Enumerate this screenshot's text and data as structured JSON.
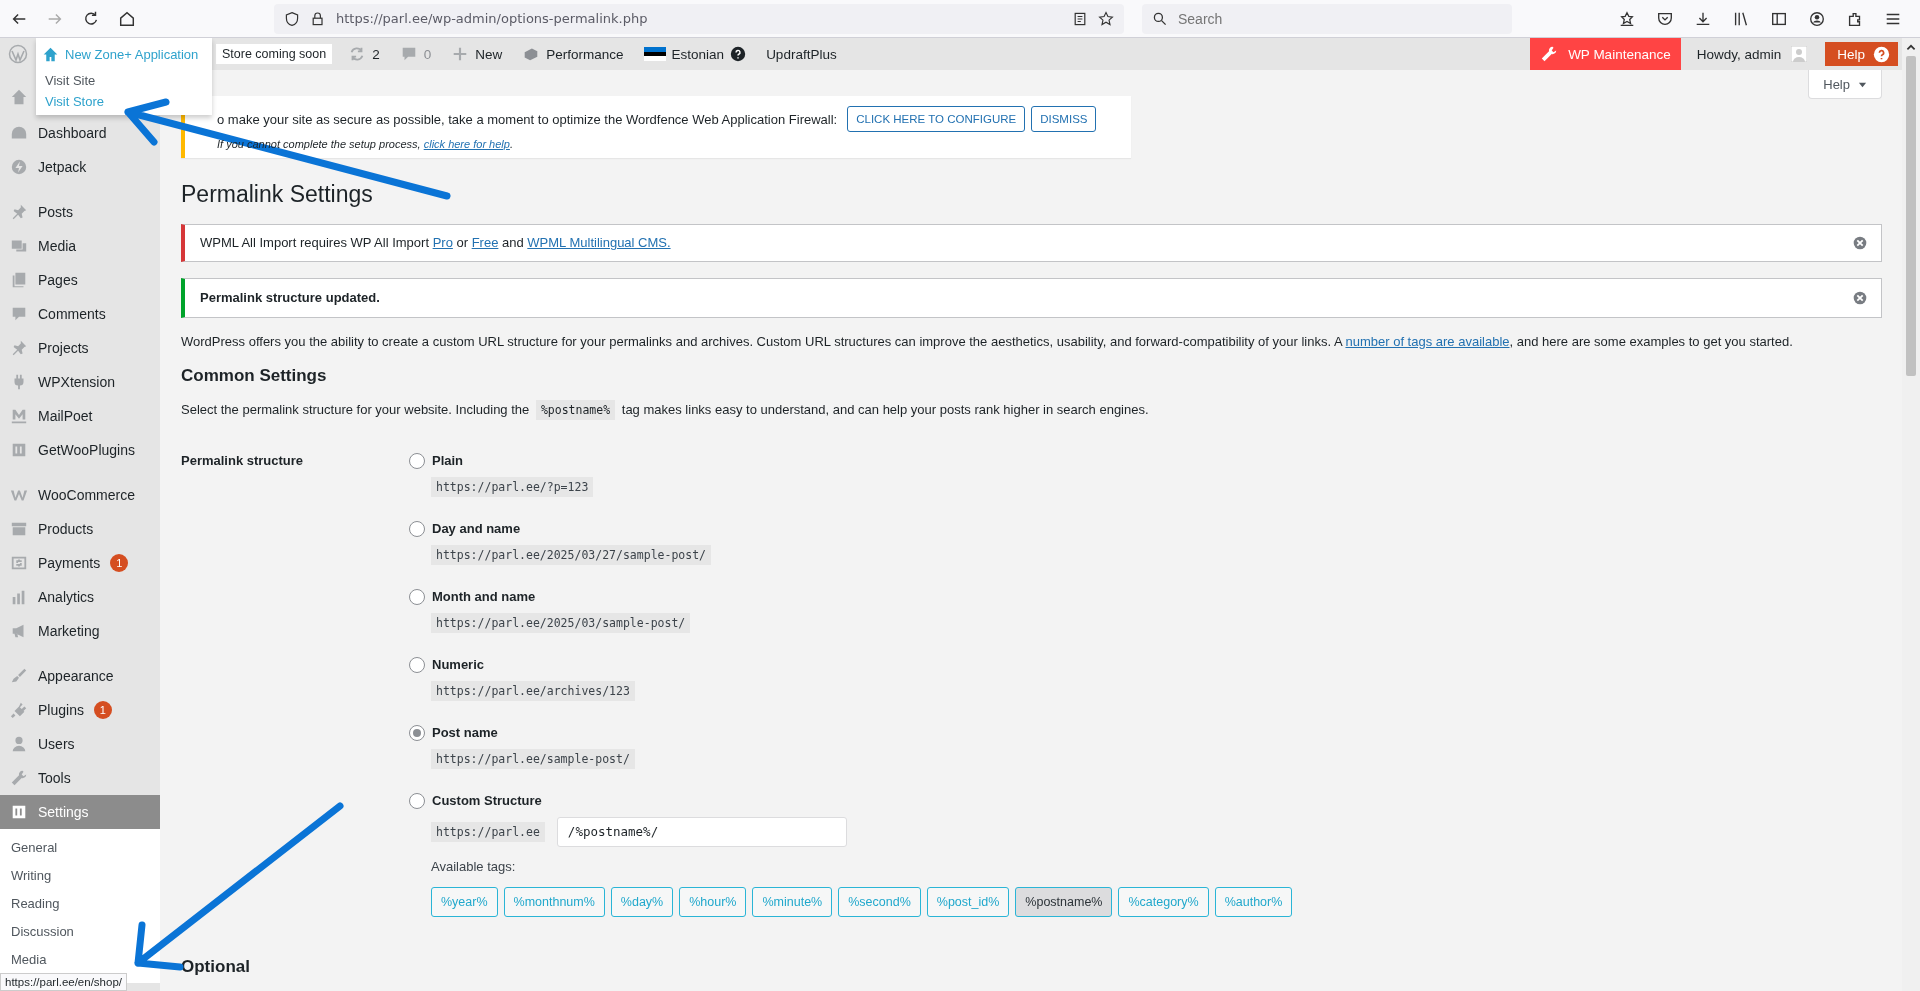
{
  "browser": {
    "address": "https://parl.ee/wp-admin/options-permalink.php",
    "search": {
      "placeholder": "Search"
    }
  },
  "admin_bar": {
    "site_menu": {
      "title": "New Zone+ Application",
      "items": [
        {
          "label": "Visit Site",
          "selected": false
        },
        {
          "label": "Visit Store",
          "selected": true
        }
      ]
    },
    "store_badge": "Store coming soon",
    "updates": "2",
    "comments": "0",
    "new": "New",
    "performance": "Performance",
    "language": "Estonian",
    "updraftplus": "UpdraftPlus",
    "maintenance": "WP Maintenance",
    "howdy": "Howdy, admin",
    "help": "Help"
  },
  "sidebar": {
    "groups": [
      [
        {
          "label": "Dashboard",
          "selected": false
        },
        {
          "label": "Jetpack",
          "selected": false
        }
      ],
      [
        {
          "label": "Posts",
          "selected": false
        },
        {
          "label": "Media",
          "selected": false
        },
        {
          "label": "Pages",
          "selected": false
        },
        {
          "label": "Comments",
          "selected": false
        },
        {
          "label": "Projects",
          "selected": false
        },
        {
          "label": "WPXtension",
          "selected": false
        },
        {
          "label": "MailPoet",
          "selected": false
        },
        {
          "label": "GetWooPlugins",
          "selected": false
        }
      ],
      [
        {
          "label": "WooCommerce",
          "selected": false
        },
        {
          "label": "Products",
          "selected": false
        },
        {
          "label": "Payments",
          "badge": "1",
          "selected": false
        },
        {
          "label": "Analytics",
          "selected": false
        },
        {
          "label": "Marketing",
          "selected": false
        }
      ],
      [
        {
          "label": "Appearance",
          "selected": false
        },
        {
          "label": "Plugins",
          "badge": "1",
          "selected": false
        },
        {
          "label": "Users",
          "selected": false
        },
        {
          "label": "Tools",
          "selected": false
        },
        {
          "label": "Settings",
          "selected": true
        }
      ]
    ],
    "submenu": [
      {
        "label": "General",
        "selected": false
      },
      {
        "label": "Writing",
        "selected": false
      },
      {
        "label": "Reading",
        "selected": false
      },
      {
        "label": "Discussion",
        "selected": false
      },
      {
        "label": "Media",
        "selected": false
      }
    ]
  },
  "help_tab": "Help",
  "wordfence_notice": {
    "text": "o make your site as secure as possible, take a moment to optimize the Wordfence Web Application Firewall:",
    "buttons": [
      "CLICK HERE TO CONFIGURE",
      "DISMISS"
    ],
    "note": "If you cannot complete the setup process, ",
    "note_link": "click here for help",
    "note_end": "."
  },
  "page_title": "Permalink Settings",
  "notices": [
    {
      "kind": "error",
      "parts": [
        {
          "kind": "text",
          "text": "WPML All Import requires WP All Import "
        },
        {
          "kind": "link",
          "text": "Pro"
        },
        {
          "kind": "text",
          "text": " or "
        },
        {
          "kind": "link",
          "text": "Free"
        },
        {
          "kind": "text",
          "text": " and "
        },
        {
          "kind": "link",
          "text": "WPML Multilingual CMS."
        }
      ]
    },
    {
      "kind": "success",
      "parts": [
        {
          "kind": "strong",
          "text": "Permalink structure updated."
        }
      ]
    }
  ],
  "intro": {
    "text": "WordPress offers you the ability to create a custom URL structure for your permalinks and archives. Custom URL structures can improve the aesthetics, usability, and forward-compatibility of your links. A ",
    "link": "number of tags are available",
    "end": ", and here are some examples to get you started."
  },
  "common_settings": {
    "heading": "Common Settings",
    "text_before": "Select the permalink structure for your website. Including the ",
    "code": "%postname%",
    "text_after": " tag makes links easy to understand, and can help your posts rank higher in search engines."
  },
  "permalink_structure": {
    "label": "Permalink structure",
    "options": [
      {
        "label": "Plain",
        "example": "https://parl.ee/?p=123",
        "selected": false
      },
      {
        "label": "Day and name",
        "example": "https://parl.ee/2025/03/27/sample-post/",
        "selected": false
      },
      {
        "label": "Month and name",
        "example": "https://parl.ee/2025/03/sample-post/",
        "selected": false
      },
      {
        "label": "Numeric",
        "example": "https://parl.ee/archives/123",
        "selected": false
      },
      {
        "label": "Post name",
        "example": "https://parl.ee/sample-post/",
        "selected": true
      }
    ],
    "custom": {
      "label": "Custom Structure",
      "selected": false,
      "prefix": "https://parl.ee",
      "value": "/%postname%/"
    },
    "tags_label": "Available tags:",
    "tags": [
      {
        "label": "%year%",
        "selected": false
      },
      {
        "label": "%monthnum%",
        "selected": false
      },
      {
        "label": "%day%",
        "selected": false
      },
      {
        "label": "%hour%",
        "selected": false
      },
      {
        "label": "%minute%",
        "selected": false
      },
      {
        "label": "%second%",
        "selected": false
      },
      {
        "label": "%post_id%",
        "selected": false
      },
      {
        "label": "%postname%",
        "selected": true
      },
      {
        "label": "%category%",
        "selected": false
      },
      {
        "label": "%author%",
        "selected": false
      }
    ]
  },
  "optional_heading": "Optional",
  "status_url": "https://parl.ee/en/shop/"
}
